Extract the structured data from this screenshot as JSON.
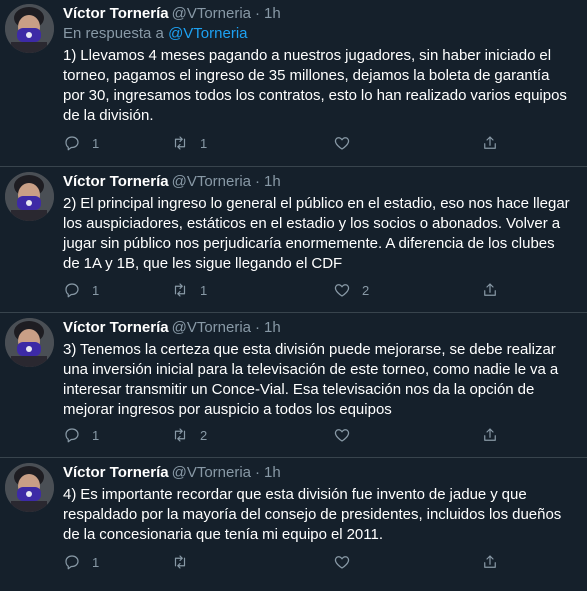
{
  "tweets": [
    {
      "name": "Víctor Tornería",
      "handle": "@VTorneria",
      "dot": "·",
      "time": "1h",
      "reply_prefix": "En respuesta a",
      "reply_mention": "@VTorneria",
      "lines": [
        "1) Llevamos 4 meses pagando a nuestros jugadores, sin haber iniciado el",
        "torneo, pagamos el ingreso de 35 millones, dejamos la boleta de garantía",
        "por 30, ingresamos todos los contratos, esto lo han realizado varios equipos",
        "de la división."
      ],
      "replies": "1",
      "retweets": "1",
      "likes": ""
    },
    {
      "name": "Víctor Tornería",
      "handle": "@VTorneria",
      "dot": "·",
      "time": "1h",
      "lines": [
        "2) El principal ingreso lo general el público en el estadio, eso nos hace llegar",
        "los auspiciadores, estáticos en el estadio y los socios o abonados. Volver a",
        "jugar sin público nos perjudicaría enormemente. A diferencia de los clubes",
        "de 1A y 1B, que les sigue llegando el CDF"
      ],
      "replies": "1",
      "retweets": "1",
      "likes": "2"
    },
    {
      "name": "Víctor Tornería",
      "handle": "@VTorneria",
      "dot": "·",
      "time": "1h",
      "lines": [
        "3) Tenemos la certeza que esta división puede mejorarse, se debe realizar",
        "una inversión inicial para la televisación de este torneo, como nadie le va a",
        "interesar transmitir un Conce-Vial. Esa televisación nos da la opción de",
        "mejorar ingresos por auspicio a todos los equipos"
      ],
      "replies": "1",
      "retweets": "2",
      "likes": ""
    },
    {
      "name": "Víctor Tornería",
      "handle": "@VTorneria",
      "dot": "·",
      "time": "1h",
      "lines": [
        "4) Es importante recordar que esta división fue invento de jadue y que",
        "respaldado por la mayoría del consejo de presidentes, incluidos los dueños",
        "de la concesionaria que tenía mi equipo el 2011."
      ],
      "replies": "1",
      "retweets": "",
      "likes": ""
    }
  ],
  "icons": {
    "reply": "reply-icon",
    "retweet": "retweet-icon",
    "like": "heart-icon",
    "share": "share-icon"
  }
}
